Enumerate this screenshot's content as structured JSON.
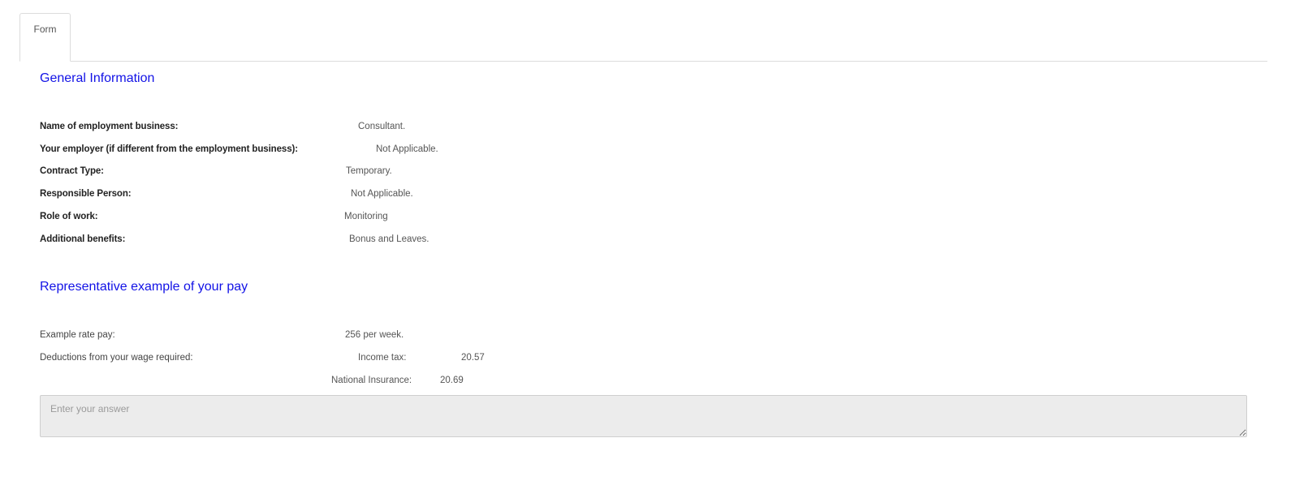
{
  "tabs": [
    {
      "label": "Form"
    }
  ],
  "general": {
    "title": "General Information",
    "rows": [
      {
        "label": "Name of employment business:",
        "value": "Consultant."
      },
      {
        "label": "Your employer (if different from the employment business):",
        "value": "Not Applicable."
      },
      {
        "label": "Contract Type:",
        "value": "Temporary."
      },
      {
        "label": "Responsible Person:",
        "value": "Not Applicable."
      },
      {
        "label": "Role of work:",
        "value": "Monitoring"
      },
      {
        "label": "Additional benefits:",
        "value": "Bonus and Leaves."
      }
    ]
  },
  "pay": {
    "title": "Representative example of your pay",
    "rate_label": "Example rate pay:",
    "rate_value": "256 per week.",
    "deductions_label": "Deductions from your wage required:",
    "income_tax_label": "Income tax:",
    "income_tax_value": "20.57",
    "ni_label": "National Insurance:",
    "ni_value": "20.69"
  },
  "answer": {
    "placeholder": "Enter your answer",
    "value": ""
  }
}
